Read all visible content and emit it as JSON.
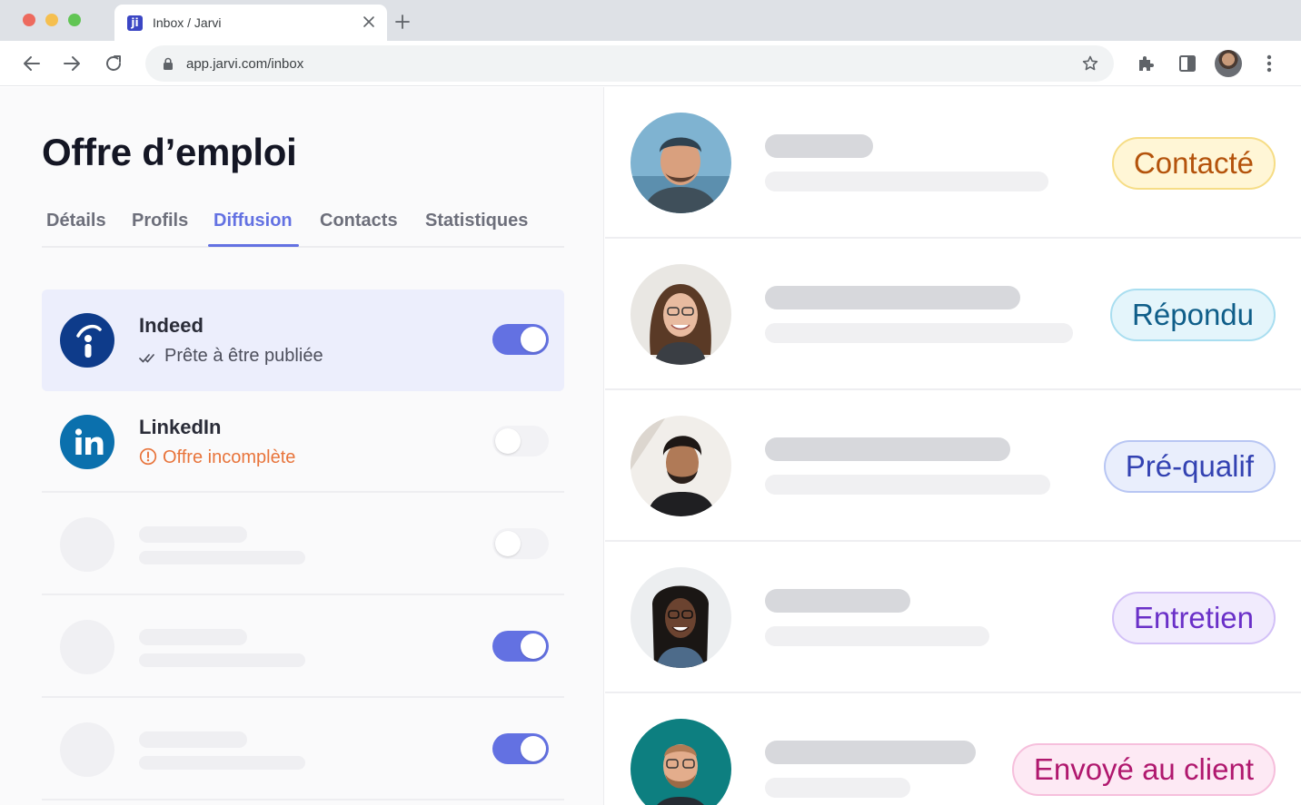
{
  "browser": {
    "tab_title": "Inbox / Jarvi",
    "tab_favicon": "ji",
    "url": "app.jarvi.com/inbox"
  },
  "page": {
    "title": "Offre d’emploi",
    "tabs": [
      {
        "label": "Détails"
      },
      {
        "label": "Profils"
      },
      {
        "label": "Diffusion",
        "active": true
      },
      {
        "label": "Contacts"
      },
      {
        "label": "Statistiques"
      }
    ]
  },
  "channels": [
    {
      "name": "Indeed",
      "status": "Prête à être publiée",
      "status_icon": "double-check-icon",
      "enabled": true,
      "selected": true
    },
    {
      "name": "LinkedIn",
      "status": "Offre incomplète",
      "status_icon": "warning-circle-icon",
      "enabled": false
    },
    {
      "placeholder": true,
      "enabled": false
    },
    {
      "placeholder": true,
      "enabled": true
    },
    {
      "placeholder": true,
      "enabled": true
    }
  ],
  "candidates": [
    {
      "status": "Contacté",
      "status_color": "#b4530c"
    },
    {
      "status": "Répondu",
      "status_color": "#0f5e89"
    },
    {
      "status": "Pré-qualif",
      "status_color": "#3342b2"
    },
    {
      "status": "Entretien",
      "status_color": "#6a30c8"
    },
    {
      "status": "Envoyé au client",
      "status_color": "#b0186e"
    }
  ],
  "colors": {
    "accent": "#6371e2",
    "indeed": "#0e3b8a",
    "linkedin": "#0b70ad",
    "warning": "#e8743b"
  }
}
